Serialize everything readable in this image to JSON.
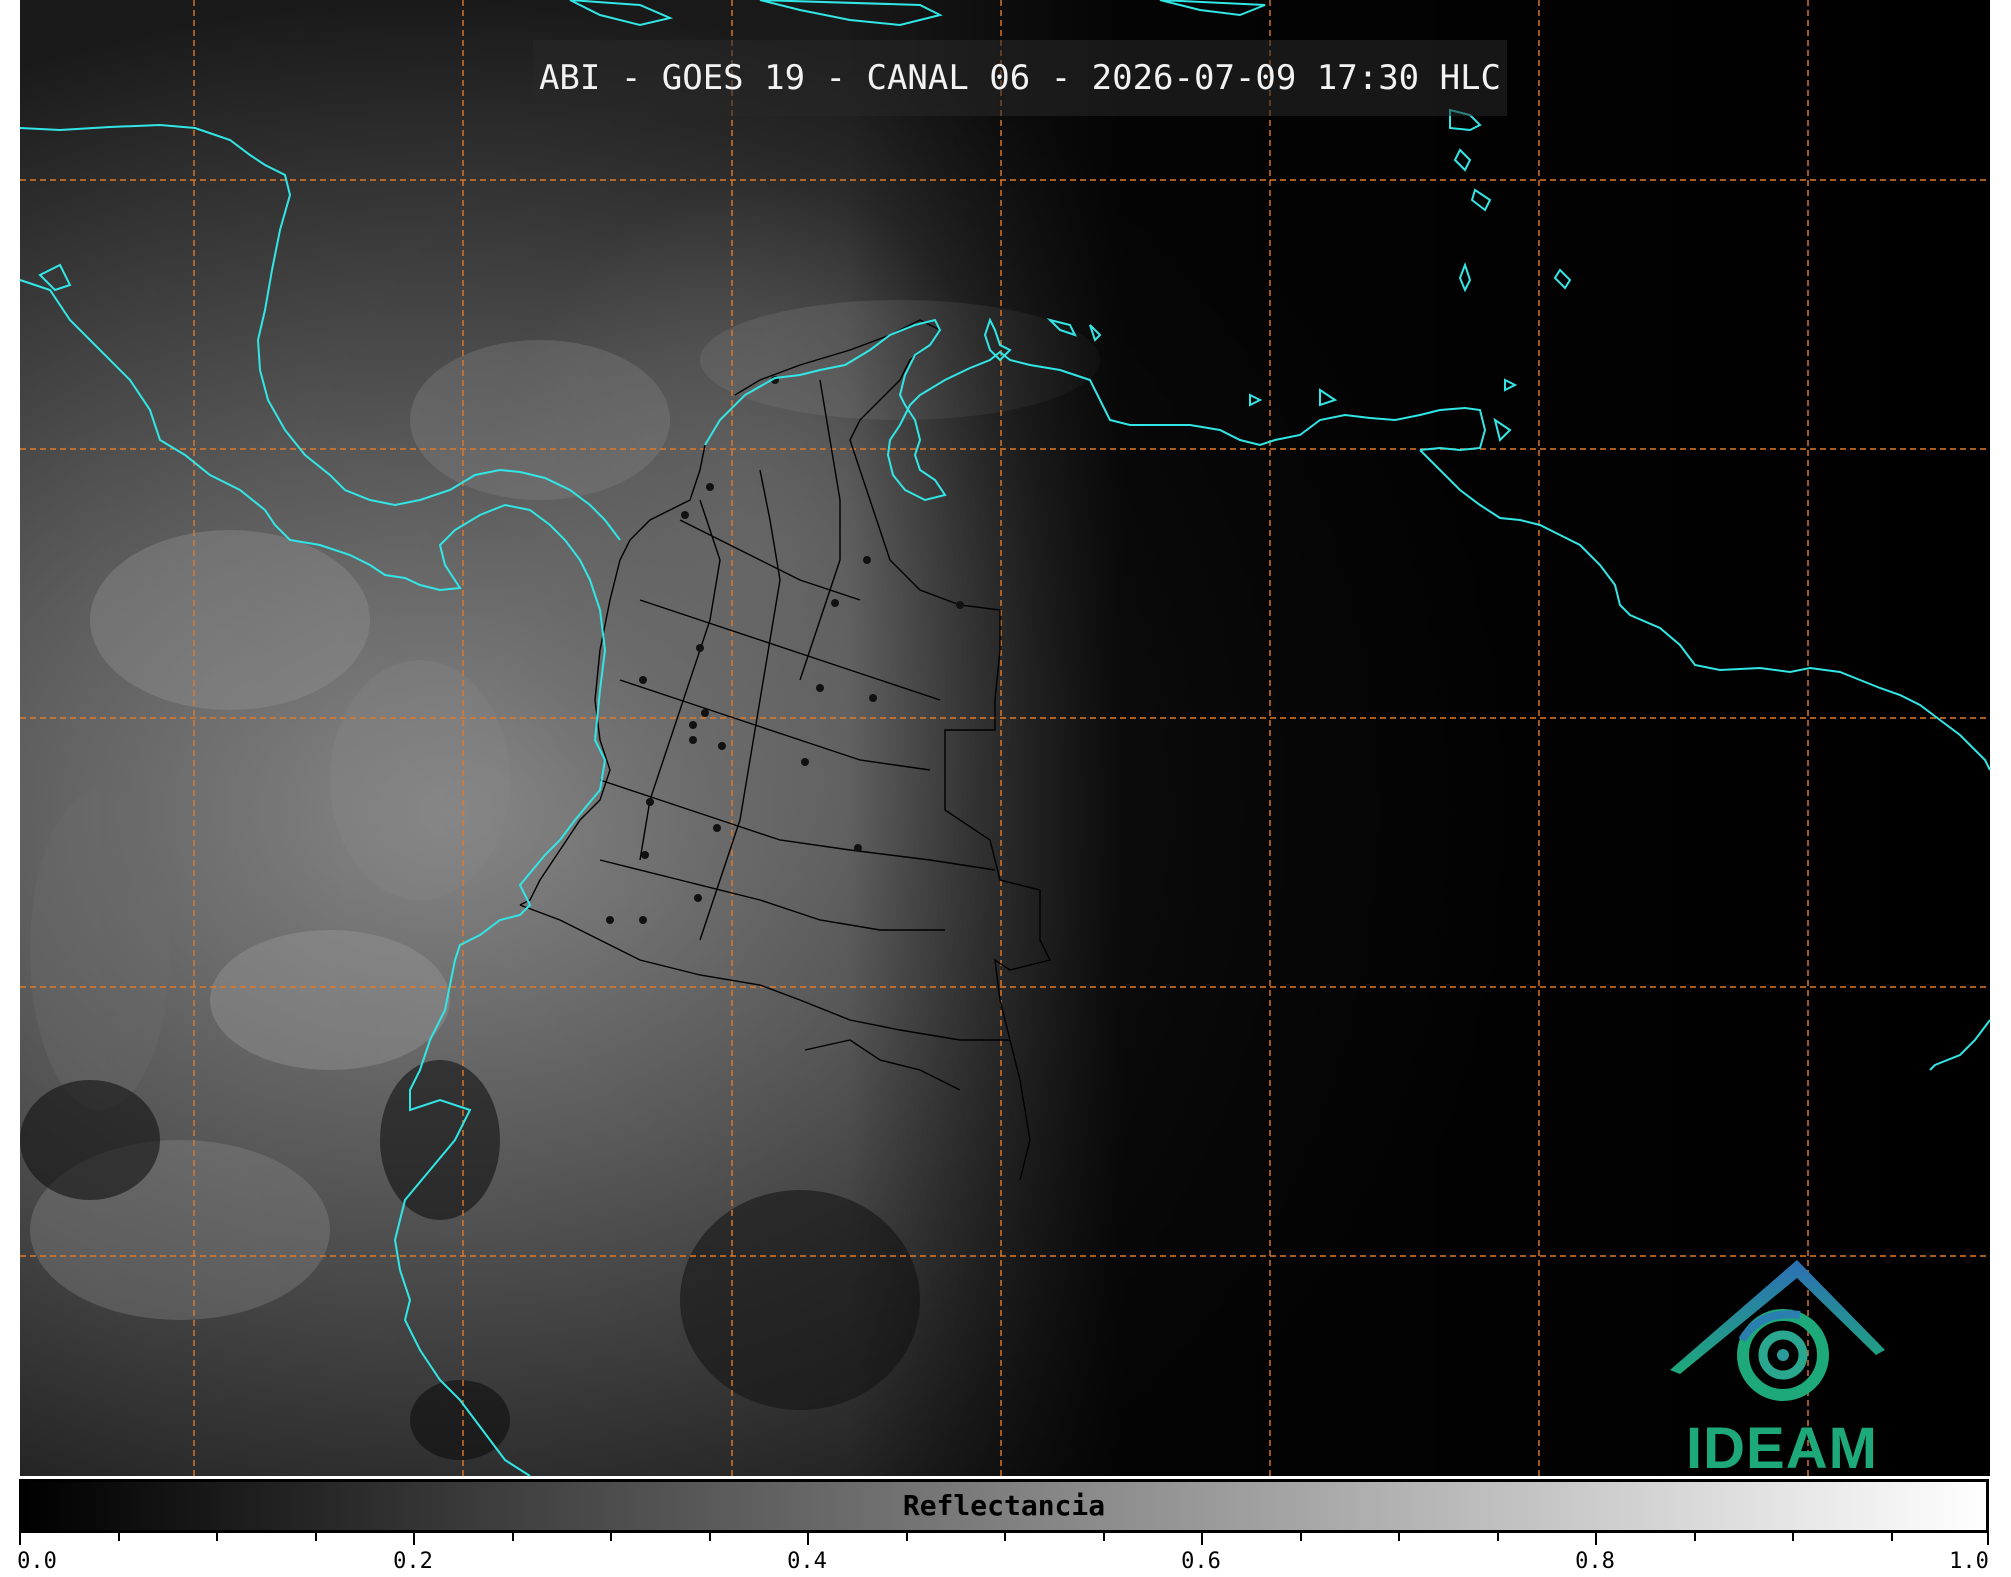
{
  "header": {
    "title": "ABI - GOES 19 - CANAL 06 - 2026-07-09 17:30 HLC"
  },
  "colorbar": {
    "label": "Reflectancia",
    "min": 0.0,
    "max": 1.0,
    "major_ticks": [
      "0.0",
      "0.2",
      "0.4",
      "0.6",
      "0.8",
      "1.0"
    ],
    "minor_tick_count_between_majors": 3
  },
  "logo": {
    "text": "IDEAM",
    "icon": "ideam-logo-icon"
  },
  "colors": {
    "coastline": "#33e6e6",
    "gridlines": "#e07a2a",
    "borders": "#000000",
    "background_dark": "#050505",
    "logo_green": "#1ea97a",
    "logo_blue": "#2d6fb5"
  }
}
